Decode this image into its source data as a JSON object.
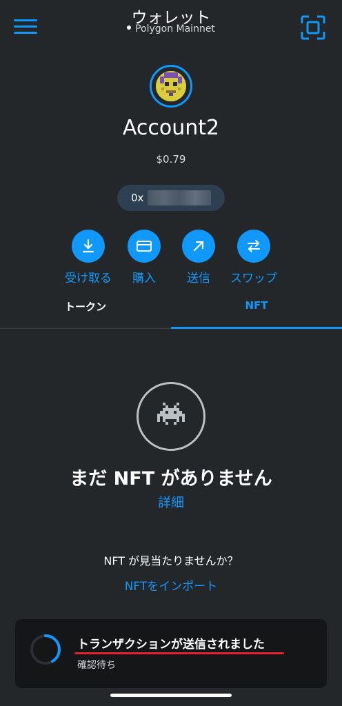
{
  "header": {
    "title": "ウォレット",
    "network": "Polygon Mainnet",
    "menu_icon": "hamburger-menu-icon",
    "scan_icon": "scan-qr-icon"
  },
  "account": {
    "name": "Account2",
    "balance": "$0.79",
    "address_prefix": "0x"
  },
  "actions": [
    {
      "label": "受け取る",
      "icon": "download-icon"
    },
    {
      "label": "購入",
      "icon": "card-icon"
    },
    {
      "label": "送信",
      "icon": "arrow-up-right-icon"
    },
    {
      "label": "スワップ",
      "icon": "swap-icon"
    }
  ],
  "tabs": {
    "tokens": "トークン",
    "nft": "NFT",
    "active": "NFT"
  },
  "empty_state": {
    "title": "まだ NFT がありません",
    "learn_more": "詳細",
    "not_found": "NFT が見当たりませんか？",
    "import": "NFTをインポート"
  },
  "toast": {
    "title": "トランザクションが送信されました",
    "subtitle": "確認待ち"
  },
  "colors": {
    "background": "#24272a",
    "accent": "#1098fc",
    "highlight": "#e0222d"
  }
}
